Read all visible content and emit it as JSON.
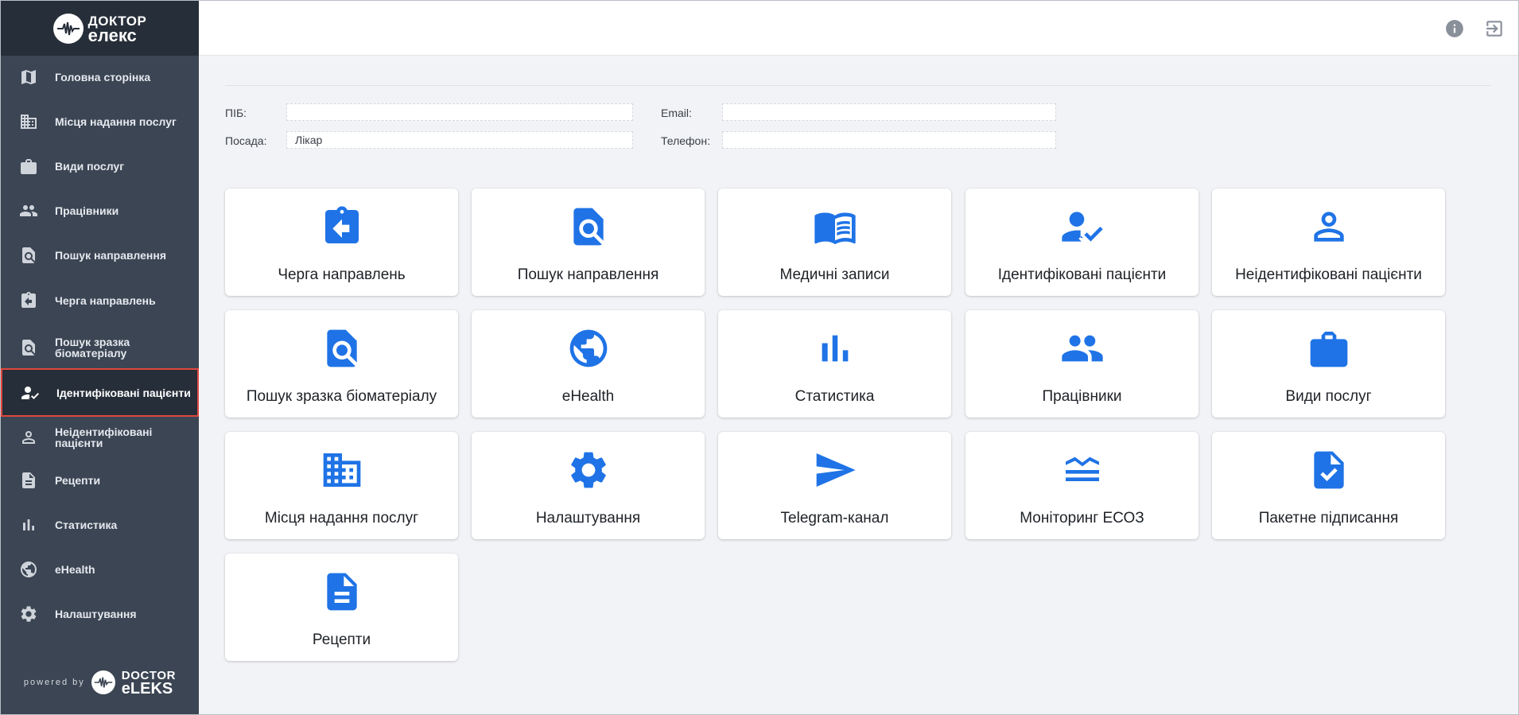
{
  "app": {
    "logo_line1": "ДОКТОР",
    "logo_line2": "елекс",
    "powered_by": "powered by",
    "powered_line1": "DOCTOR",
    "powered_line2": "eLEKS",
    "accent_color": "#1f73e6",
    "active_outline_color": "#e0473f"
  },
  "sidebar": {
    "items": [
      {
        "label": "Головна сторінка",
        "icon": "map-icon"
      },
      {
        "label": "Місця надання послуг",
        "icon": "building-icon"
      },
      {
        "label": "Види послуг",
        "icon": "briefcase-icon"
      },
      {
        "label": "Працівники",
        "icon": "people-icon"
      },
      {
        "label": "Пошук направлення",
        "icon": "search-document-icon"
      },
      {
        "label": "Черга направлень",
        "icon": "clipboard-arrow-icon"
      },
      {
        "label": "Пошук зразка біоматеріалу",
        "icon": "search-document-icon"
      },
      {
        "label": "Ідентифіковані пацієнти",
        "icon": "person-check-icon",
        "active": true
      },
      {
        "label": "Неідентифіковані пацієнти",
        "icon": "person-outline-icon"
      },
      {
        "label": "Рецепти",
        "icon": "document-icon"
      },
      {
        "label": "Статистика",
        "icon": "bar-chart-icon"
      },
      {
        "label": "eHealth",
        "icon": "globe-icon"
      },
      {
        "label": "Налаштування",
        "icon": "gear-icon"
      }
    ]
  },
  "header": {
    "info_icon": "info-icon",
    "logout_icon": "logout-icon"
  },
  "form": {
    "name_label": "ПІБ:",
    "name_value": "",
    "position_label": "Посада:",
    "position_value": "Лікар",
    "email_label": "Email:",
    "email_value": "",
    "phone_label": "Телефон:",
    "phone_value": ""
  },
  "tiles": [
    {
      "label": "Черга направлень",
      "icon": "clipboard-arrow-icon"
    },
    {
      "label": "Пошук направлення",
      "icon": "search-document-icon"
    },
    {
      "label": "Медичні записи",
      "icon": "open-book-icon"
    },
    {
      "label": "Ідентифіковані пацієнти",
      "icon": "person-check-icon"
    },
    {
      "label": "Неідентифіковані пацієнти",
      "icon": "person-outline-icon"
    },
    {
      "label": "Пошук зразка біоматеріалу",
      "icon": "search-document-icon"
    },
    {
      "label": "eHealth",
      "icon": "globe-icon"
    },
    {
      "label": "Статистика",
      "icon": "bar-chart-icon"
    },
    {
      "label": "Працівники",
      "icon": "people-icon"
    },
    {
      "label": "Види послуг",
      "icon": "briefcase-icon"
    },
    {
      "label": "Місця надання послуг",
      "icon": "building-icon"
    },
    {
      "label": "Налаштування",
      "icon": "gear-icon"
    },
    {
      "label": "Telegram-канал",
      "icon": "send-icon"
    },
    {
      "label": "Моніторинг ЕСОЗ",
      "icon": "monitoring-icon"
    },
    {
      "label": "Пакетне підписання",
      "icon": "document-check-icon"
    },
    {
      "label": "Рецепти",
      "icon": "document-icon"
    }
  ]
}
